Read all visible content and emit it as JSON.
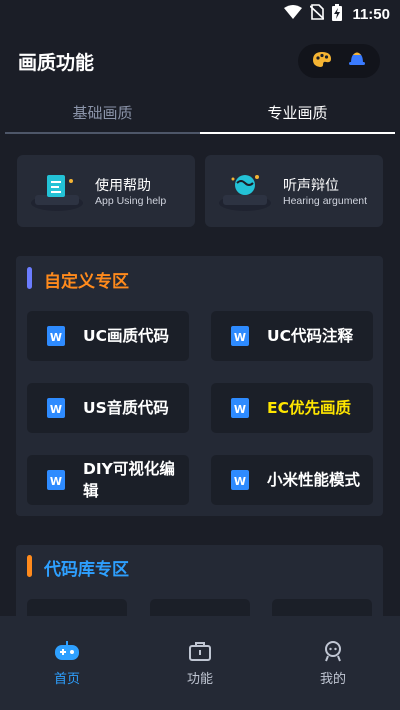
{
  "status_bar": {
    "time": "11:50"
  },
  "header": {
    "title": "画质功能"
  },
  "tabs": [
    {
      "label": "基础画质",
      "active": false
    },
    {
      "label": "专业画质",
      "active": true
    }
  ],
  "help_cards": [
    {
      "title": "使用帮助",
      "subtitle": "App Using help"
    },
    {
      "title": "听声辩位",
      "subtitle": "Hearing argument"
    }
  ],
  "custom_section": {
    "title": "自定义专区",
    "title_color": "#ff8a1c",
    "marker_color": "#6b7cff",
    "items": [
      {
        "label": "UC画质代码",
        "color": "#ffffff"
      },
      {
        "label": "UC代码注释",
        "color": "#ffffff"
      },
      {
        "label": "US音质代码",
        "color": "#ffffff"
      },
      {
        "label": "EC优先画质",
        "color": "#ffe600"
      },
      {
        "label": "DIY可视化编辑",
        "color": "#ffffff"
      },
      {
        "label": "小米性能模式",
        "color": "#ffffff"
      }
    ]
  },
  "library_section": {
    "title": "代码库专区",
    "title_color": "#2ea0ff",
    "marker_color": "#ff8a1c"
  },
  "bottom_nav": [
    {
      "label": "首页",
      "icon": "gamepad-icon",
      "active": true
    },
    {
      "label": "功能",
      "icon": "toolbox-icon",
      "active": false
    },
    {
      "label": "我的",
      "icon": "profile-icon",
      "active": false
    }
  ]
}
